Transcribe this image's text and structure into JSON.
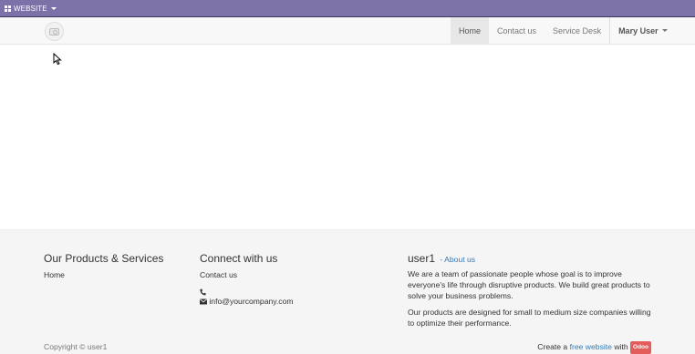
{
  "admin_bar": {
    "website_menu_label": "WEBSITE",
    "background": "#7c72a8"
  },
  "navbar": {
    "logo_icon": "camera-icon",
    "items": [
      {
        "label": "Home",
        "active": true
      },
      {
        "label": "Contact us",
        "active": false
      },
      {
        "label": "Service Desk",
        "active": false
      }
    ],
    "user_menu_label": "Mary User"
  },
  "footer": {
    "products": {
      "title": "Our Products & Services",
      "links": [
        "Home"
      ]
    },
    "connect": {
      "title": "Connect with us",
      "contact_link": "Contact us",
      "phone": "",
      "email": "info@yourcompany.com"
    },
    "about": {
      "title": "user1",
      "about_link": "- About us",
      "paragraph_1": "We are a team of passionate people whose goal is to improve everyone's life through disruptive products. We build great products to solve your business problems.",
      "paragraph_2": "Our products are designed for small to medium size companies willing to optimize their performance."
    },
    "copyright": "Copyright © user1",
    "create_prefix": "Create a",
    "create_link": "free website",
    "create_with": "with",
    "odoo_badge": "Odoo"
  },
  "colors": {
    "link": "#337ab7",
    "odoo_badge": "#e35d5b",
    "footer_bg": "#f5f5f5"
  }
}
